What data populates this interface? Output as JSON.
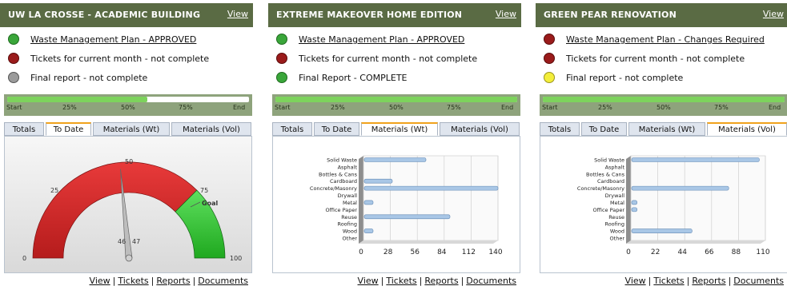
{
  "footer": {
    "view": "View",
    "tickets": "Tickets",
    "reports": "Reports",
    "documents": "Documents",
    "sep": "|"
  },
  "progress_labels": [
    "Start",
    "25%",
    "50%",
    "75%",
    "End"
  ],
  "tabs": [
    "Totals",
    "To Date",
    "Materials (Wt)",
    "Materials (Vol)"
  ],
  "colors": {
    "header": "#5a6b44",
    "green": "#3aa63a",
    "red": "#9a1b1b",
    "gray": "#9a9a9a",
    "yellow": "#f3ee3a",
    "progress_fill": "#7dd35c",
    "tab_accent": "#f0a21c"
  },
  "categories": [
    "Solid Waste",
    "Asphalt",
    "Bottles & Cans",
    "Cardboard",
    "Concrete/Masonry",
    "Drywall",
    "Metal",
    "Office Paper",
    "Reuse",
    "Roofing",
    "Wood",
    "Other"
  ],
  "panels": [
    {
      "title": "UW LA CROSSE - ACADEMIC BUILDING",
      "view": "View",
      "statuses": [
        {
          "text": "Waste Management Plan - APPROVED",
          "color": "green",
          "link": true
        },
        {
          "text": "Tickets for current month - not complete",
          "color": "red",
          "link": false
        },
        {
          "text": "Final report - not complete",
          "color": "gray",
          "link": false
        }
      ],
      "progress": 0.58,
      "active_tab": 1,
      "gauge": {
        "ticks": [
          "0",
          "25",
          "50",
          "75",
          "100"
        ],
        "goal_label": "Goal",
        "needle_labels": [
          "46",
          "47"
        ],
        "value": 47,
        "goal": 75
      }
    },
    {
      "title": "EXTREME MAKEOVER HOME EDITION",
      "view": "View",
      "statuses": [
        {
          "text": "Waste Management Plan - APPROVED",
          "color": "green",
          "link": true
        },
        {
          "text": "Tickets for current month - not complete",
          "color": "red",
          "link": false
        },
        {
          "text": "Final Report - COMPLETE",
          "color": "green",
          "link": false
        }
      ],
      "progress": 1.0,
      "active_tab": 2,
      "bar": {
        "xticks": [
          "0",
          "28",
          "56",
          "84",
          "112",
          "140"
        ],
        "xmax": 140
      }
    },
    {
      "title": "GREEN PEAR RENOVATION",
      "view": "View",
      "statuses": [
        {
          "text": "Waste Management Plan - Changes Required",
          "color": "red",
          "link": true
        },
        {
          "text": "Tickets for current month - not complete",
          "color": "red",
          "link": false
        },
        {
          "text": "Final report - not complete",
          "color": "yellow",
          "link": false
        }
      ],
      "progress": 1.0,
      "active_tab": 3,
      "bar": {
        "xticks": [
          "0",
          "22",
          "44",
          "66",
          "88",
          "110"
        ],
        "xmax": 110
      }
    }
  ],
  "chart_data": [
    {
      "type": "gauge",
      "title": "",
      "range": [
        0,
        100
      ],
      "ticks": [
        0,
        25,
        50,
        75,
        100
      ],
      "value": 47,
      "goal": 75
    },
    {
      "type": "bar",
      "orientation": "horizontal",
      "categories": [
        "Solid Waste",
        "Asphalt",
        "Bottles & Cans",
        "Cardboard",
        "Concrete/Masonry",
        "Drywall",
        "Metal",
        "Office Paper",
        "Reuse",
        "Roofing",
        "Wood",
        "Other"
      ],
      "values": [
        65,
        0,
        0,
        30,
        140,
        0,
        10,
        0,
        90,
        0,
        10,
        0
      ],
      "xlim": [
        0,
        140
      ],
      "xticks": [
        0,
        28,
        56,
        84,
        112,
        140
      ]
    },
    {
      "type": "bar",
      "orientation": "horizontal",
      "categories": [
        "Solid Waste",
        "Asphalt",
        "Bottles & Cans",
        "Cardboard",
        "Concrete/Masonry",
        "Drywall",
        "Metal",
        "Office Paper",
        "Reuse",
        "Roofing",
        "Wood",
        "Other"
      ],
      "values": [
        105,
        0,
        0,
        0,
        80,
        0,
        5,
        5,
        0,
        0,
        50,
        0
      ],
      "xlim": [
        0,
        110
      ],
      "xticks": [
        0,
        22,
        44,
        66,
        88,
        110
      ]
    }
  ]
}
